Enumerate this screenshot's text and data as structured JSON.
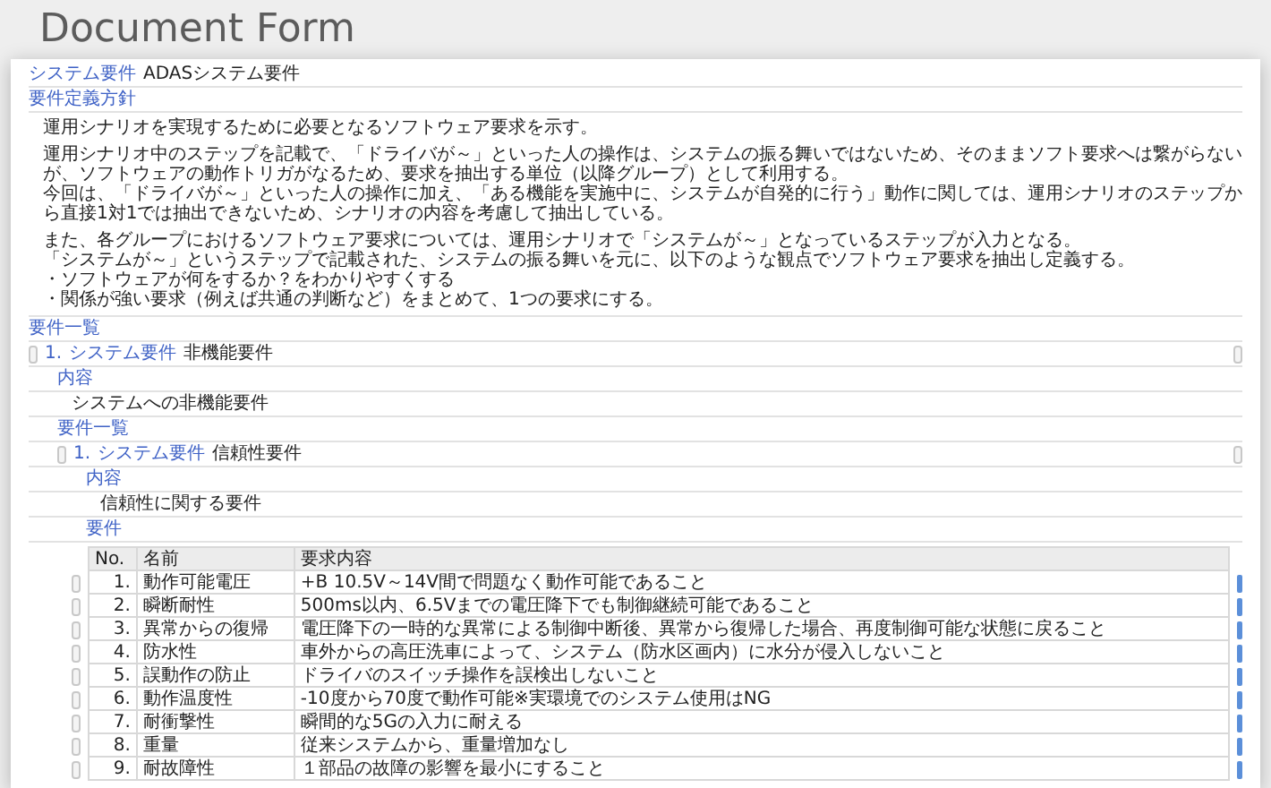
{
  "page_title": "Document Form",
  "document": {
    "header": {
      "label": "システム要件",
      "title": "ADASシステム要件"
    },
    "policy": {
      "heading": "要件定義方針",
      "paragraph_groups": [
        [
          "運用シナリオを実現するために必要となるソフトウェア要求を示す。"
        ],
        [
          "運用シナリオ中のステップを記載で、「ドライバが～」といった人の操作は、システムの振る舞いではないため、そのままソフト要求へは繋がらないが、ソフトウェアの動作トリガがなるため、要求を抽出する単位（以降グループ）として利用する。",
          "今回は、「ドライバが～」といった人の操作に加え、「ある機能を実施中に、システムが自発的に行う」動作に関しては、運用シナリオのステップから直接1対1では抽出できないため、シナリオの内容を考慮して抽出している。"
        ],
        [
          "また、各グループにおけるソフトウェア要求については、運用シナリオで「システムが～」となっているステップが入力となる。",
          "「システムが～」というステップで記載された、システムの振る舞いを元に、以下のような観点でソフトウェア要求を抽出し定義する。",
          "・ソフトウェアが何をするか？をわかりやすくする",
          "・関係が強い要求（例えば共通の判断など）をまとめて、1つの要求にする。"
        ]
      ]
    },
    "list": {
      "heading": "要件一覧",
      "items": [
        {
          "number": "1.",
          "label": "システム要件",
          "title": "非機能要件",
          "content_heading": "内容",
          "content": "システムへの非機能要件",
          "list_heading": "要件一覧",
          "children": [
            {
              "number": "1.",
              "label": "システム要件",
              "title": "信頼性要件",
              "content_heading": "内容",
              "content": "信頼性に関する要件",
              "table_heading": "要件",
              "table": {
                "columns": [
                  "No.",
                  "名前",
                  "要求内容"
                ],
                "rows": [
                  [
                    "1.",
                    "動作可能電圧",
                    "+B 10.5V～14V間で問題なく動作可能であること"
                  ],
                  [
                    "2.",
                    "瞬断耐性",
                    "500ms以内、6.5Vまでの電圧降下でも制御継続可能であること"
                  ],
                  [
                    "3.",
                    "異常からの復帰",
                    "電圧降下の一時的な異常による制御中断後、異常から復帰した場合、再度制御可能な状態に戻ること"
                  ],
                  [
                    "4.",
                    "防水性",
                    "車外からの高圧洗車によって、システム（防水区画内）に水分が侵入しないこと"
                  ],
                  [
                    "5.",
                    "誤動作の防止",
                    "ドライバのスイッチ操作を誤検出しないこと"
                  ],
                  [
                    "6.",
                    "動作温度性",
                    "-10度から70度で動作可能※実環境でのシステム使用はNG"
                  ],
                  [
                    "7.",
                    "耐衝撃性",
                    "瞬間的な5Gの入力に耐える"
                  ],
                  [
                    "8.",
                    "重量",
                    "従来システムから、重量増加なし"
                  ],
                  [
                    "9.",
                    "耐故障性",
                    "１部品の故障の影響を最小にすること"
                  ]
                ]
              }
            }
          ]
        }
      ]
    }
  }
}
